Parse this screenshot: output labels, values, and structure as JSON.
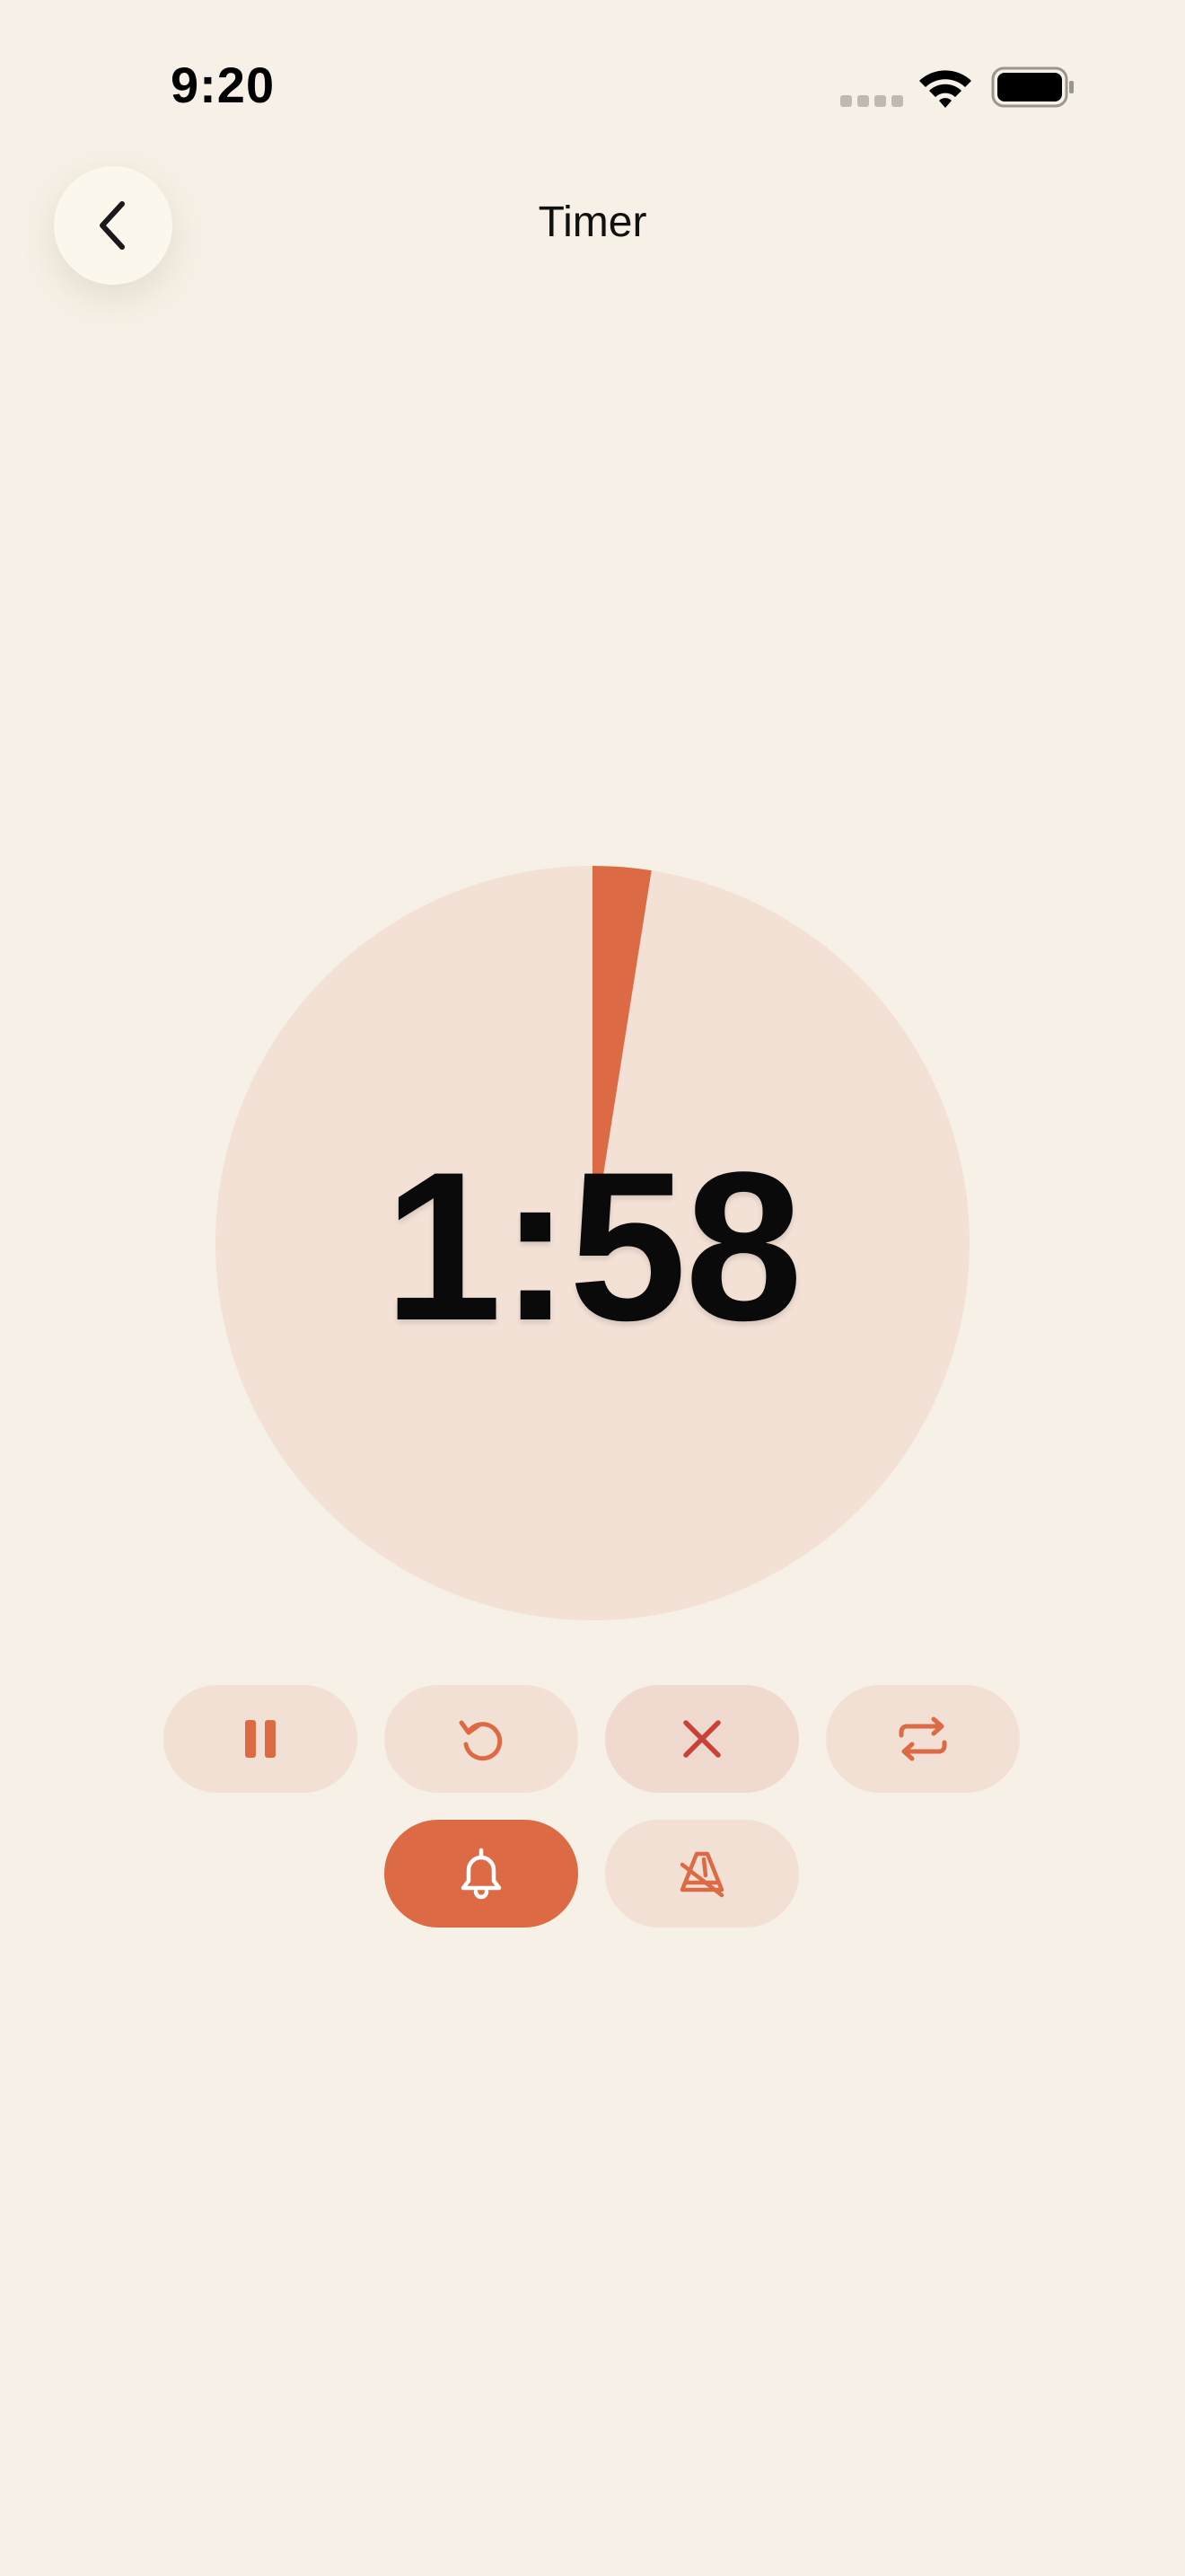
{
  "status_bar": {
    "time": "9:20"
  },
  "header": {
    "title": "Timer",
    "back_icon": "chevron-left-icon"
  },
  "timer": {
    "remaining": "1:58",
    "elapsed_fraction": 0.025
  },
  "colors": {
    "background": "#F6F0E6",
    "accent": "#DC6A45",
    "dial_track": "#F3E1D6",
    "button_bg": "#F3E0D4",
    "cancel_icon": "#C9423A"
  },
  "controls": {
    "row1": [
      {
        "icon": "pause-icon"
      },
      {
        "icon": "reset-icon"
      },
      {
        "icon": "close-icon"
      },
      {
        "icon": "repeat-icon"
      }
    ],
    "row2": [
      {
        "icon": "bell-icon",
        "active": true
      },
      {
        "icon": "metronome-off-icon",
        "active": false
      }
    ]
  }
}
